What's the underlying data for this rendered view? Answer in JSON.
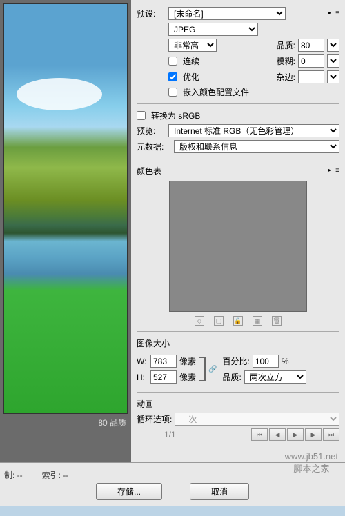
{
  "preset": {
    "label": "预设:",
    "value": "[未命名]"
  },
  "format": {
    "value": "JPEG"
  },
  "quality": {
    "levelLabel": "非常高",
    "label": "品质:",
    "value": "80"
  },
  "blur": {
    "label": "模糊:",
    "value": "0"
  },
  "matte": {
    "label": "杂边:",
    "value": ""
  },
  "progressive": {
    "label": "连续"
  },
  "optimized": {
    "label": "优化"
  },
  "embedProfile": {
    "label": "嵌入颜色配置文件"
  },
  "convertSRGB": {
    "label": "转换为 sRGB"
  },
  "preview": {
    "label": "预览:",
    "value": "Internet 标准 RGB（无色彩管理）"
  },
  "metadata": {
    "label": "元数据:",
    "value": "版权和联系信息"
  },
  "colorTable": {
    "label": "颜色表"
  },
  "imageSize": {
    "label": "图像大小",
    "w": {
      "label": "W:",
      "value": "783",
      "unit": "像素"
    },
    "h": {
      "label": "H:",
      "value": "527",
      "unit": "像素"
    },
    "percent": {
      "label": "百分比:",
      "value": "100",
      "suffix": "%"
    },
    "resample": {
      "label": "品质:",
      "value": "两次立方"
    }
  },
  "animation": {
    "label": "动画",
    "loopLabel": "循环选项:",
    "loopValue": "一次",
    "frame": "1/1"
  },
  "previewStatus": {
    "quality": "80 品质"
  },
  "statusBar": {
    "limit": "制: --",
    "index": "索引: --"
  },
  "buttons": {
    "save": "存储...",
    "cancel": "取消"
  },
  "watermark": "www.jb51.net\n脚本之家"
}
